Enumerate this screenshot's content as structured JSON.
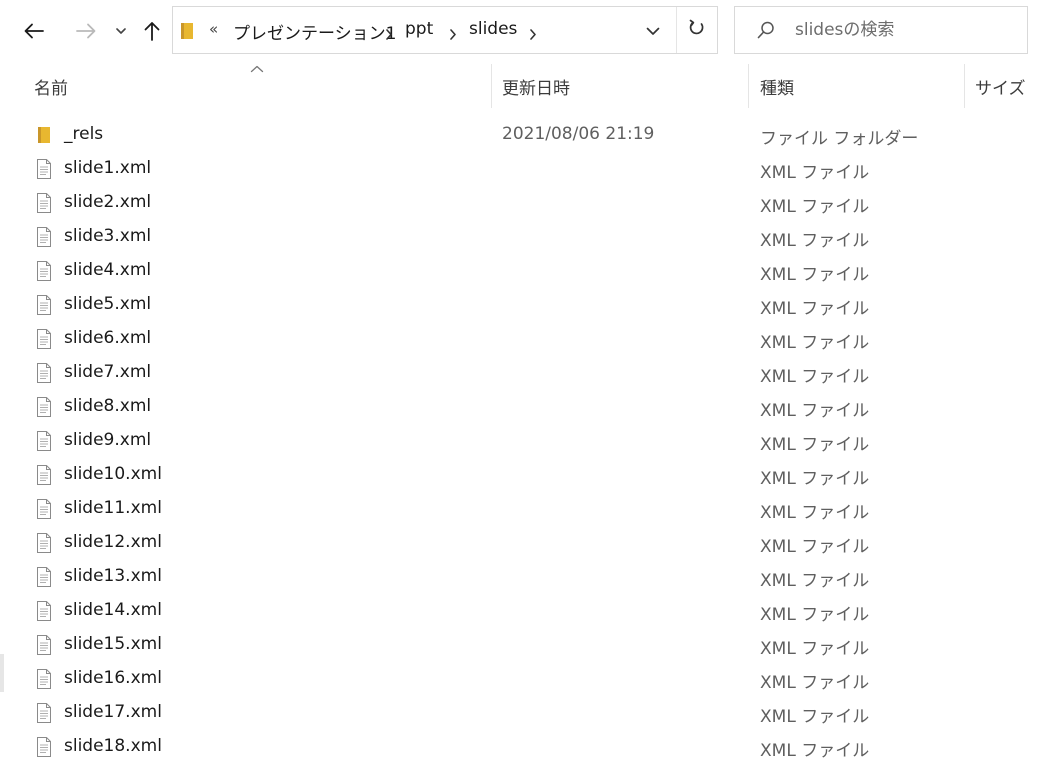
{
  "toolbar": {
    "back_label": "戻る",
    "forward_label": "進む",
    "recent_label": "最近表示した場所",
    "up_label": "上へ"
  },
  "address": {
    "overflow": "«",
    "crumbs": [
      "プレゼンテーション1",
      "ppt",
      "slides"
    ]
  },
  "search": {
    "placeholder": "slidesの検索",
    "value": ""
  },
  "columns": {
    "name": "名前",
    "date": "更新日時",
    "type": "種類",
    "size": "サイズ"
  },
  "files": [
    {
      "name": "_rels",
      "date": "2021/08/06 21:19",
      "type": "ファイル フォルダー",
      "icon": "folder-icon"
    },
    {
      "name": "slide1.xml",
      "date": "",
      "type": "XML ファイル",
      "icon": "xml-file-icon"
    },
    {
      "name": "slide2.xml",
      "date": "",
      "type": "XML ファイル",
      "icon": "xml-file-icon"
    },
    {
      "name": "slide3.xml",
      "date": "",
      "type": "XML ファイル",
      "icon": "xml-file-icon"
    },
    {
      "name": "slide4.xml",
      "date": "",
      "type": "XML ファイル",
      "icon": "xml-file-icon"
    },
    {
      "name": "slide5.xml",
      "date": "",
      "type": "XML ファイル",
      "icon": "xml-file-icon"
    },
    {
      "name": "slide6.xml",
      "date": "",
      "type": "XML ファイル",
      "icon": "xml-file-icon"
    },
    {
      "name": "slide7.xml",
      "date": "",
      "type": "XML ファイル",
      "icon": "xml-file-icon"
    },
    {
      "name": "slide8.xml",
      "date": "",
      "type": "XML ファイル",
      "icon": "xml-file-icon"
    },
    {
      "name": "slide9.xml",
      "date": "",
      "type": "XML ファイル",
      "icon": "xml-file-icon"
    },
    {
      "name": "slide10.xml",
      "date": "",
      "type": "XML ファイル",
      "icon": "xml-file-icon"
    },
    {
      "name": "slide11.xml",
      "date": "",
      "type": "XML ファイル",
      "icon": "xml-file-icon"
    },
    {
      "name": "slide12.xml",
      "date": "",
      "type": "XML ファイル",
      "icon": "xml-file-icon"
    },
    {
      "name": "slide13.xml",
      "date": "",
      "type": "XML ファイル",
      "icon": "xml-file-icon"
    },
    {
      "name": "slide14.xml",
      "date": "",
      "type": "XML ファイル",
      "icon": "xml-file-icon"
    },
    {
      "name": "slide15.xml",
      "date": "",
      "type": "XML ファイル",
      "icon": "xml-file-icon"
    },
    {
      "name": "slide16.xml",
      "date": "",
      "type": "XML ファイル",
      "icon": "xml-file-icon"
    },
    {
      "name": "slide17.xml",
      "date": "",
      "type": "XML ファイル",
      "icon": "xml-file-icon"
    },
    {
      "name": "slide18.xml",
      "date": "",
      "type": "XML ファイル",
      "icon": "xml-file-icon"
    }
  ],
  "icons": {
    "back": "back-arrow-icon",
    "forward": "forward-arrow-icon",
    "recent": "chevron-down-icon",
    "up": "up-arrow-icon",
    "address_folder": "folder-icon",
    "separator": "chevron-right-icon",
    "dropdown": "chevron-down-icon",
    "refresh": "refresh-icon",
    "search": "search-icon",
    "sort": "sort-up-icon"
  },
  "colors": {
    "folder": "#e8b730",
    "folder_dark": "#c9962a",
    "nav_enabled": "#1a1a1a",
    "nav_disabled": "#b9b9b9",
    "border": "#d9d9d9"
  }
}
